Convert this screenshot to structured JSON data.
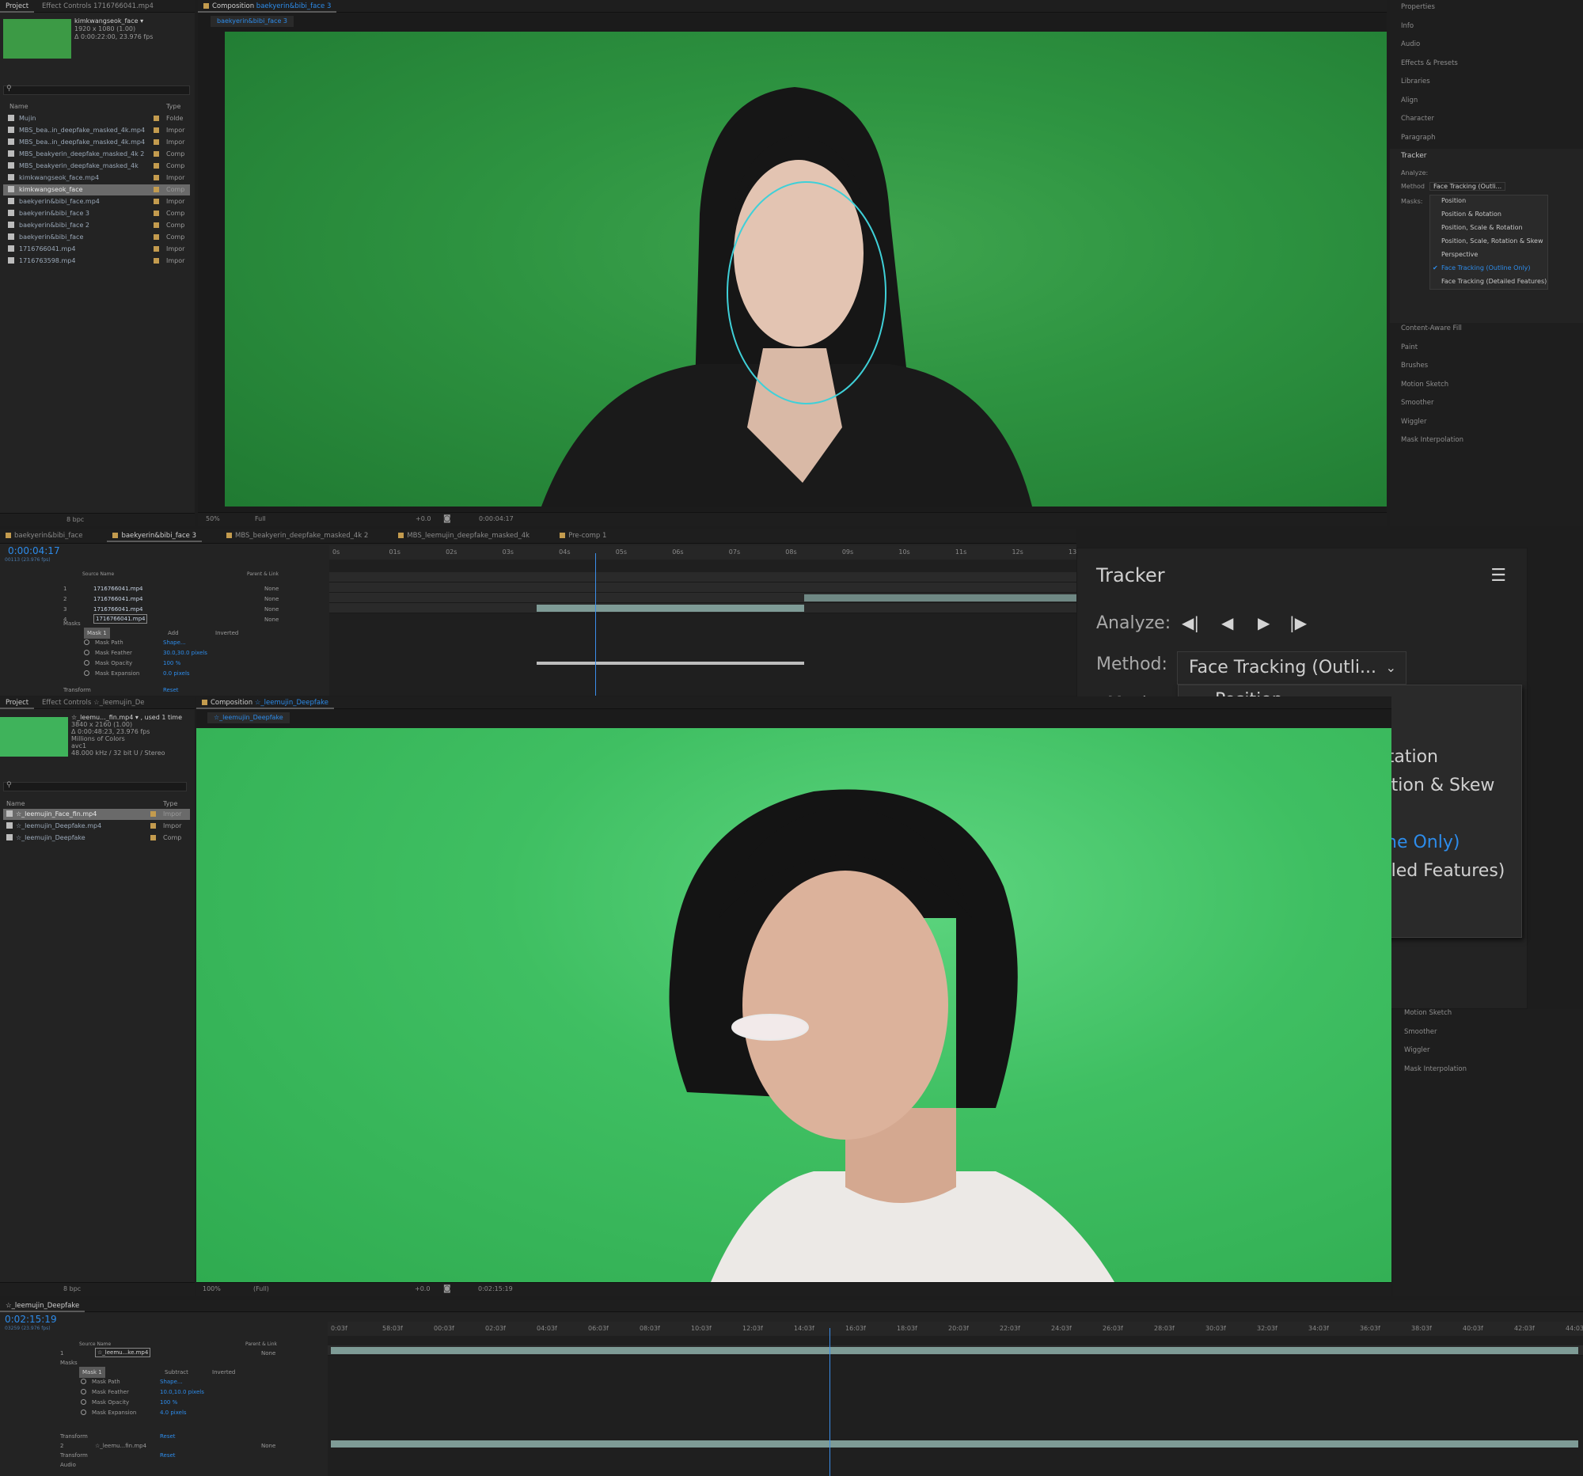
{
  "top_project": {
    "tabs": [
      "Project",
      "Effect Controls 1716766041.mp4"
    ],
    "item_name": "kimkwangseok_face ▾",
    "item_info1": "1920 x 1080 (1.00)",
    "item_info2": "Δ 0:00:22:00, 23.976 fps",
    "search_placeholder": "",
    "col_name": "Name",
    "col_type": "Type",
    "items": [
      {
        "name": "Mujin",
        "type": "Folde"
      },
      {
        "name": "MBS_bea..in_deepfake_masked_4k.mp4",
        "type": "Impor"
      },
      {
        "name": "MBS_bea..in_deepfake_masked_4k.mp4",
        "type": "Impor"
      },
      {
        "name": "MBS_beakyerin_deepfake_masked_4k 2",
        "type": "Comp"
      },
      {
        "name": "MBS_beakyerin_deepfake_masked_4k",
        "type": "Comp"
      },
      {
        "name": "kimkwangseok_face.mp4",
        "type": "Impor"
      },
      {
        "name": "kimkwangseok_face",
        "type": "Comp"
      },
      {
        "name": "baekyerin&bibi_face.mp4",
        "type": "Impor"
      },
      {
        "name": "baekyerin&bibi_face 3",
        "type": "Comp"
      },
      {
        "name": "baekyerin&bibi_face 2",
        "type": "Comp"
      },
      {
        "name": "baekyerin&bibi_face",
        "type": "Comp"
      },
      {
        "name": "1716766041.mp4",
        "type": "Impor"
      },
      {
        "name": "1716763598.mp4",
        "type": "Impor"
      }
    ],
    "bpc": "8 bpc"
  },
  "top_comp": {
    "tab_prefix": "Composition",
    "tab_name": "baekyerin&bibi_face 3",
    "sub_tab": "baekyerin&bibi_face 3",
    "zoom": "50%",
    "quality": "Full",
    "exposure": "+0.0",
    "timecode": "0:00:04:17"
  },
  "right_panel": {
    "items_top": [
      "Properties",
      "Info",
      "Audio",
      "Effects & Presets",
      "Libraries",
      "Align",
      "Character",
      "Paragraph"
    ],
    "tracker_title": "Tracker",
    "analyze_label": "Analyze:",
    "method_label": "Method",
    "method_value": "Face Tracking (Outli...",
    "masks_label": "Masks:",
    "menu": [
      "Position",
      "Position & Rotation",
      "Position, Scale & Rotation",
      "Position, Scale, Rotation & Skew",
      "Perspective",
      "Face Tracking (Outline Only)",
      "Face Tracking (Detailed Features)"
    ],
    "items_bottom": [
      "Content-Aware Fill",
      "Paint",
      "Brushes",
      "Motion Sketch",
      "Smoother",
      "Wiggler",
      "Mask Interpolation"
    ]
  },
  "timeline1": {
    "tabs": [
      "baekyerin&bibi_face",
      "baekyerin&bibi_face 3",
      "MBS_beakyerin_deepfake_masked_4k 2",
      "MBS_leemujin_deepfake_masked_4k",
      "Pre-comp 1"
    ],
    "timecode": "0:00:04:17",
    "fps": "00113 (23.976 fps)",
    "col_source": "Source Name",
    "col_parent": "Parent & Link",
    "layers": [
      {
        "num": "1",
        "name": "1716766041.mp4",
        "parent": "None"
      },
      {
        "num": "2",
        "name": "1716766041.mp4",
        "parent": "None"
      },
      {
        "num": "3",
        "name": "1716766041.mp4",
        "parent": "None"
      },
      {
        "num": "4",
        "name": "1716766041.mp4",
        "parent": "None"
      }
    ],
    "masks_label": "Masks",
    "mask1": "Mask 1",
    "mode": "Add",
    "inverted": "Inverted",
    "props": [
      {
        "name": "Mask Path",
        "value": "Shape..."
      },
      {
        "name": "Mask Feather",
        "value": "30.0,30.0 pixels"
      },
      {
        "name": "Mask Opacity",
        "value": "100 %"
      },
      {
        "name": "Mask Expansion",
        "value": "0.0 pixels"
      }
    ],
    "transform": "Transform",
    "reset": "Reset",
    "ruler": [
      "0s",
      "01s",
      "02s",
      "03s",
      "04s",
      "05s",
      "06s",
      "07s",
      "08s",
      "09s",
      "10s",
      "11s",
      "12s",
      "13s"
    ]
  },
  "bottom_project": {
    "tabs": [
      "Project",
      "Effect Controls ☆_leemujin_De"
    ],
    "item_name": "☆_leemu..._fin.mp4 ▾ , used 1 time",
    "item_info1": "3840 x 2160 (1.00)",
    "item_info2": "Δ 0:00:48:23, 23.976 fps",
    "item_info3": "Millions of Colors",
    "item_info4": "avc1",
    "item_info5": "48.000 kHz / 32 bit U / Stereo",
    "col_name": "Name",
    "col_type": "Type",
    "items": [
      {
        "name": "☆_leemujin_Face_fin.mp4",
        "type": "Impor"
      },
      {
        "name": "☆_leemujin_Deepfake.mp4",
        "type": "Impor"
      },
      {
        "name": "☆_leemujin_Deepfake",
        "type": "Comp"
      }
    ],
    "bpc": "8 bpc"
  },
  "bottom_comp": {
    "tab_prefix": "Composition",
    "tab_name": "☆_leemujin_Deepfake",
    "sub_tab": "☆_leemujin_Deepfake",
    "zoom": "100%",
    "quality": "(Full)",
    "exposure": "+0.0",
    "timecode": "0:02:15:19"
  },
  "bottom_right": {
    "items": [
      "Motion Sketch",
      "Smoother",
      "Wiggler",
      "Mask Interpolation"
    ]
  },
  "timeline2": {
    "tab": "☆_leemujin_Deepfake",
    "timecode": "0:02:15:19",
    "fps": "03259 (23.976 fps)",
    "col_source": "Source Name",
    "col_parent": "Parent & Link",
    "layer1": {
      "num": "1",
      "name": "☆_leemu...ke.mp4",
      "parent": "None"
    },
    "masks_label": "Masks",
    "mask1": "Mask 1",
    "mode": "Subtract",
    "inverted": "Inverted",
    "props": [
      {
        "name": "Mask Path",
        "value": "Shape..."
      },
      {
        "name": "Mask Feather",
        "value": "10.0,10.0 pixels"
      },
      {
        "name": "Mask Opacity",
        "value": "100 %"
      },
      {
        "name": "Mask Expansion",
        "value": "4.0 pixels"
      }
    ],
    "transform": "Transform",
    "reset": "Reset",
    "layer2": {
      "num": "2",
      "name": "☆_leemu...fin.mp4",
      "parent": "None"
    },
    "transform2": "Transform",
    "audio": "Audio",
    "ruler": [
      "0:03f",
      "58:03f",
      "00:03f",
      "02:03f",
      "04:03f",
      "06:03f",
      "08:03f",
      "10:03f",
      "12:03f",
      "14:03f",
      "16:03f",
      "18:03f",
      "20:03f",
      "22:03f",
      "24:03f",
      "26:03f",
      "28:03f",
      "30:03f",
      "32:03f",
      "34:03f",
      "36:03f",
      "38:03f",
      "40:03f",
      "42:03f",
      "44:03f"
    ]
  },
  "colors": {
    "accent": "#2d8ceb",
    "green_screen": "#2e9a40",
    "green_screen2": "#45c46e",
    "track_bar": "#7e9b96",
    "folder": "#c39b4e"
  }
}
